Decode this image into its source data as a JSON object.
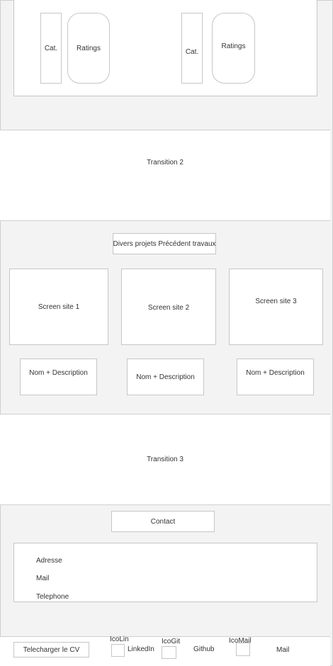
{
  "top_section": {
    "cards": [
      {
        "cat": "Cat.",
        "ratings": "Ratings"
      },
      {
        "cat": "Cat.",
        "ratings": "Ratings"
      }
    ]
  },
  "transition_2": "Transition 2",
  "projects": {
    "header": "Divers projets Précédent travaux",
    "screens": [
      "Screen site 1",
      "Screen site 2",
      "Screen site 3"
    ],
    "descriptions": [
      "Nom + Description",
      "Nom + Description",
      "Nom + Description"
    ]
  },
  "transition_3": "Transition 3",
  "contact": {
    "button": "Contact",
    "lines": [
      "Adresse",
      "Mail",
      "Telephone"
    ]
  },
  "footer": {
    "cv_button": "Telecharger le CV",
    "linkedin_icon_label": "IcoLin",
    "linkedin_label": "LinkedIn",
    "github_icon_label": "IcoGit",
    "github_label": "Github",
    "mail_icon_label": "IcoMail",
    "mail_label": "Mail"
  }
}
